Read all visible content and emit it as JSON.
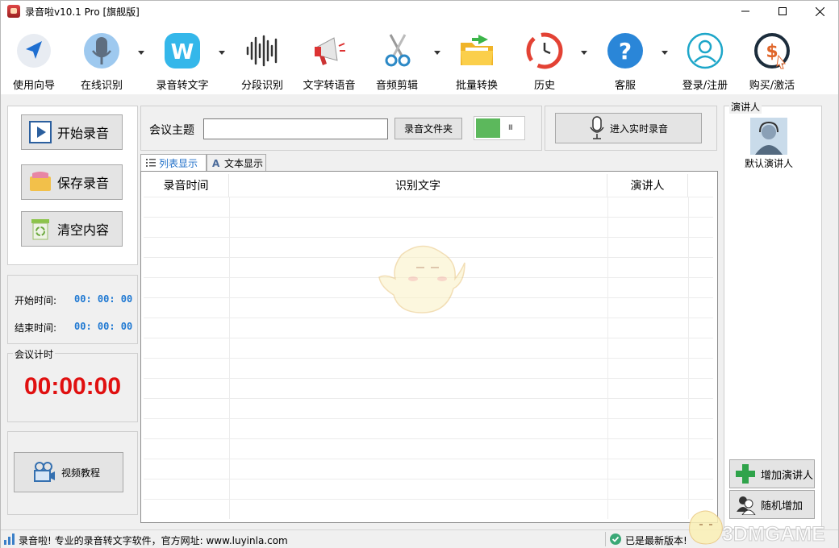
{
  "window": {
    "title": "录音啦v10.1 Pro [旗舰版]"
  },
  "toolbar": {
    "items": [
      {
        "label": "使用向导",
        "icon": "navigation-arrow-icon"
      },
      {
        "label": "在线识别",
        "icon": "microphone-icon"
      },
      {
        "label": "录音转文字",
        "icon": "w-logo-icon"
      },
      {
        "label": "分段识别",
        "icon": "waveform-icon"
      },
      {
        "label": "文字转语音",
        "icon": "megaphone-icon"
      },
      {
        "label": "音频剪辑",
        "icon": "scissors-icon"
      },
      {
        "label": "批量转换",
        "icon": "folder-icon"
      },
      {
        "label": "历史",
        "icon": "history-clock-icon"
      },
      {
        "label": "客服",
        "icon": "help-icon"
      },
      {
        "label": "登录/注册",
        "icon": "user-icon"
      },
      {
        "label": "购买/激活",
        "icon": "dollar-icon"
      }
    ]
  },
  "left": {
    "start_record": "开始录音",
    "save_record": "保存录音",
    "clear_content": "清空内容",
    "start_time_label": "开始时间:",
    "start_time_value": "00: 00: 00",
    "end_time_label": "结束时间:",
    "end_time_value": "00: 00: 00",
    "meeting_timer_label": "会议计时",
    "meeting_timer_value": "00:00:00",
    "video_tutorial": "视频教程"
  },
  "center": {
    "topic_label": "会议主题",
    "topic_value": "",
    "folder_button": "录音文件夹",
    "realtime_button": "进入实时录音",
    "tabs": [
      {
        "label": "列表显示",
        "active": true
      },
      {
        "label": "文本显示",
        "active": false
      }
    ],
    "columns": [
      "录音时间",
      "识别文字",
      "演讲人"
    ]
  },
  "right": {
    "panel_title": "演讲人",
    "default_speaker": "默认演讲人",
    "add_speaker": "增加演讲人",
    "random_add": "随机增加"
  },
  "status": {
    "left_text": "录音啦! 专业的录音转文字软件，官方网址: www.luyinla.com",
    "right_text": "已是最新版本!"
  },
  "watermark": "3DMGAME",
  "colors": {
    "accent_blue": "#1e78d2",
    "timer_red": "#e01010",
    "toggle_green": "#5cb85c"
  }
}
